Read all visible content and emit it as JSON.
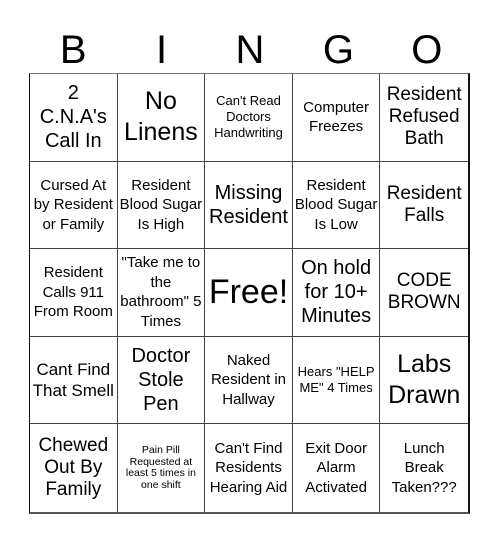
{
  "title_letters": [
    "B",
    "I",
    "N",
    "G",
    "O"
  ],
  "cells": [
    "2 C.N.A's Call In",
    "No Linens",
    "Can't Read Doctors Handwriting",
    "Computer Freezes",
    "Resident Refused Bath",
    "Cursed At by Resident or Family",
    "Resident Blood Sugar Is High",
    "Missing Resident",
    "Resident Blood Sugar Is Low",
    "Resident Falls",
    "Resident Calls 911 From Room",
    "\"Take me to the bathroom\" 5 Times",
    "Free!",
    "On hold for 10+ Minutes",
    "CODE BROWN",
    "Cant Find That Smell",
    "Doctor Stole Pen",
    "Naked Resident in Hallway",
    "Hears \"HELP ME\" 4 Times",
    "Labs Drawn",
    "Chewed Out By Family",
    "Pain Pill Requested at least 5 times in one shift",
    "Can't Find Residents Hearing Aid",
    "Exit Door Alarm Activated",
    "Lunch Break Taken???"
  ]
}
